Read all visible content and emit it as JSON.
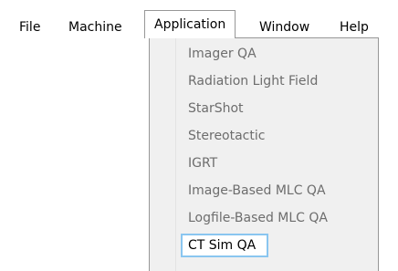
{
  "menubar": {
    "items": [
      {
        "label": "File"
      },
      {
        "label": "Machine"
      },
      {
        "label": "Application"
      },
      {
        "label": "Window"
      },
      {
        "label": "Help"
      }
    ]
  },
  "application_menu": {
    "items": [
      {
        "label": "Imager QA",
        "enabled": false
      },
      {
        "label": "Radiation Light Field",
        "enabled": false
      },
      {
        "label": "StarShot",
        "enabled": false
      },
      {
        "label": "Stereotactic",
        "enabled": false
      },
      {
        "label": "IGRT",
        "enabled": false
      },
      {
        "label": "Image-Based MLC QA",
        "enabled": false
      },
      {
        "label": "Logfile-Based MLC QA",
        "enabled": false
      },
      {
        "label": "CT Sim QA",
        "enabled": true,
        "highlighted": true
      }
    ]
  },
  "colors": {
    "disabled_text": "#6d6d6d",
    "menu_background": "#f0f0f0",
    "menu_border": "#979797",
    "highlight_border": "#8ac6f0"
  }
}
